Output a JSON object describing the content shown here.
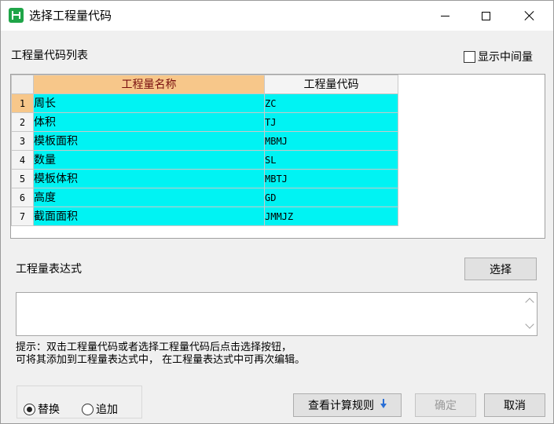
{
  "window": {
    "title": "选择工程量代码"
  },
  "list": {
    "title": "工程量代码列表",
    "show_intermediate_label": "显示中间量",
    "headers": {
      "name": "工程量名称",
      "code": "工程量代码"
    },
    "rows": [
      {
        "num": "1",
        "name": "周长",
        "code": "ZC"
      },
      {
        "num": "2",
        "name": "体积",
        "code": "TJ"
      },
      {
        "num": "3",
        "name": "模板面积",
        "code": "MBMJ"
      },
      {
        "num": "4",
        "name": "数量",
        "code": "SL"
      },
      {
        "num": "5",
        "name": "模板体积",
        "code": "MBTJ"
      },
      {
        "num": "6",
        "name": "高度",
        "code": "GD"
      },
      {
        "num": "7",
        "name": "截面面积",
        "code": "JMMJZ"
      }
    ]
  },
  "expression": {
    "label": "工程量表达式",
    "select_label": "选择",
    "value": ""
  },
  "hint": {
    "line1": "提示：双击工程量代码或者选择工程量代码后点击选择按钮，",
    "line2": "可将其添加到工程量表达式中， 在工程量表达式中可再次编辑。"
  },
  "mode": {
    "replace_label": "替换",
    "append_label": "追加",
    "selected": "替换"
  },
  "footer": {
    "rules_label": "查看计算规则",
    "ok_label": "确定",
    "cancel_label": "取消"
  },
  "colors": {
    "cell_highlight": "#00f3f3",
    "header_selected": "#f7c78a",
    "header_text": "#7a1010",
    "app_icon": "#1fa548",
    "arrow": "#2a6fd6"
  },
  "icons": [
    "app-icon",
    "minimize-icon",
    "maximize-icon",
    "close-icon",
    "arrow-down-icon",
    "scroll-up-icon",
    "scroll-down-icon"
  ]
}
